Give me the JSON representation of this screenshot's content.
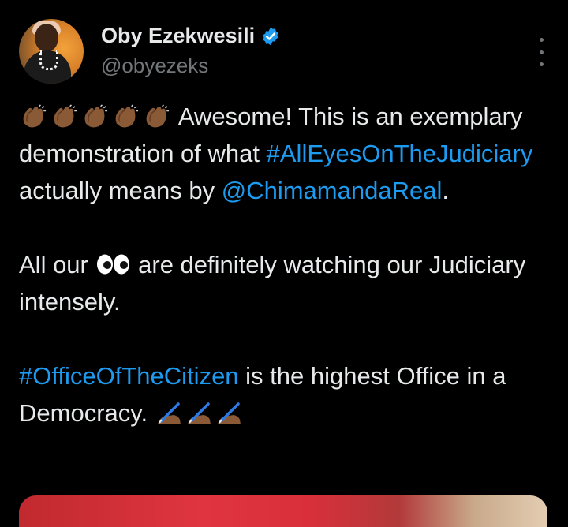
{
  "author": {
    "name": "Oby Ezekwesili",
    "handle": "@obyezeks",
    "verified": true,
    "avatar_icon": "profile-photo"
  },
  "icons": {
    "verified": "verified-badge-icon",
    "more": "more-options-icon",
    "clap": "clapping-hands-emoji",
    "eyes": "eyes-emoji",
    "writing": "writing-hand-emoji"
  },
  "colors": {
    "background": "#000000",
    "text": "#e7e9ea",
    "link": "#1d9bf0",
    "muted": "#71767b",
    "verified": "#1d9bf0"
  },
  "tweet": {
    "line1_text": "Awesome! This is an exemplary demonstration of what",
    "hashtag1": "#AllEyesOnTheJudiciary",
    "line1_after": "actually means by",
    "mention": "@ChimamandaReal",
    "line1_end": ".",
    "line2_before": "All our",
    "line2_after": "are definitely watching our Judiciary intensely.",
    "hashtag2": "#OfficeOfTheCitizen",
    "line3_after": "is the highest Office in a Democracy."
  }
}
